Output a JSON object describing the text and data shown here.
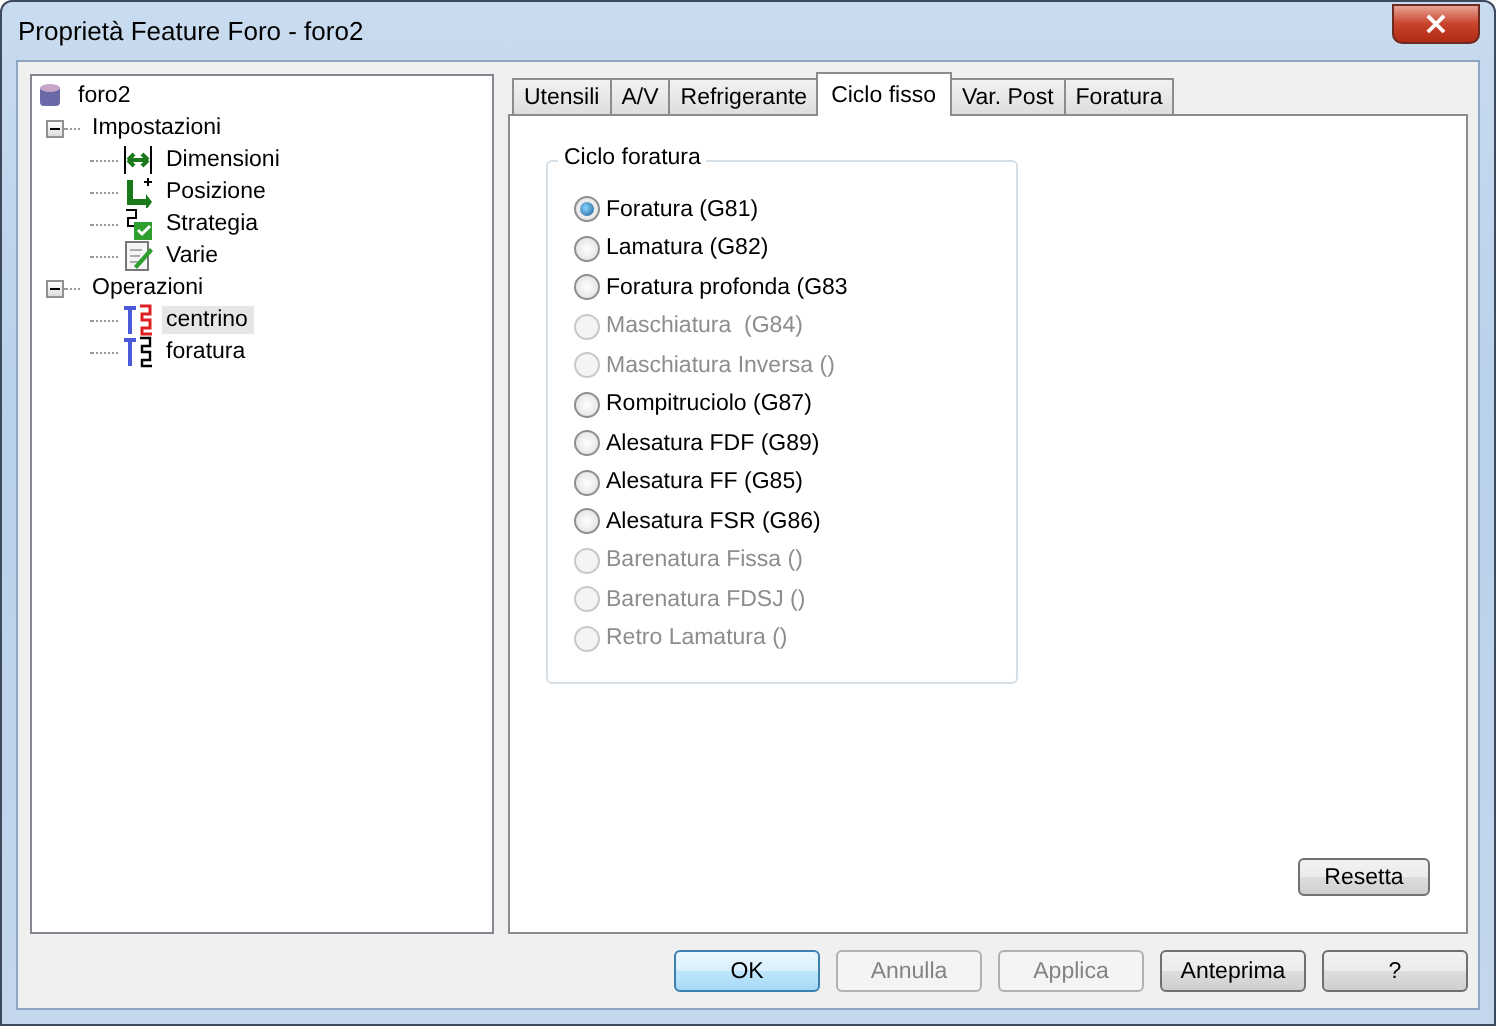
{
  "window": {
    "title": "Proprietà Feature Foro - foro2",
    "close": "×"
  },
  "tree": [
    {
      "label": "foro2",
      "kind": "database",
      "selected": false,
      "children": [
        {
          "label": "Impostazioni",
          "expanded": true,
          "selected": false,
          "children": [
            {
              "label": "Dimensioni",
              "kind": "dimension",
              "selected": false
            },
            {
              "label": "Posizione",
              "kind": "position",
              "selected": false
            },
            {
              "label": "Strategia",
              "kind": "strategy",
              "selected": false
            },
            {
              "label": "Varie",
              "kind": "notes",
              "selected": false
            }
          ]
        },
        {
          "label": "Operazioni",
          "expanded": true,
          "selected": false,
          "children": [
            {
              "label": "centrino",
              "kind": "tool-red",
              "selected": true
            },
            {
              "label": "foratura",
              "kind": "tool",
              "selected": false
            }
          ]
        }
      ]
    }
  ],
  "tabs": [
    {
      "label": "Utensili",
      "selected": false
    },
    {
      "label": "A/V",
      "selected": false
    },
    {
      "label": "Refrigerante",
      "selected": false
    },
    {
      "label": "Ciclo fisso",
      "selected": true
    },
    {
      "label": "Var. Post",
      "selected": false
    },
    {
      "label": "Foratura",
      "selected": false
    }
  ],
  "group": {
    "title": "Ciclo foratura",
    "options": [
      {
        "label": "Foratura (G81)",
        "selected": true,
        "disabled": false
      },
      {
        "label": "Lamatura (G82)",
        "selected": false,
        "disabled": false
      },
      {
        "label": "Foratura profonda (G83",
        "selected": false,
        "disabled": false
      },
      {
        "label": "Maschiatura  (G84)",
        "selected": false,
        "disabled": true
      },
      {
        "label": "Maschiatura Inversa ()",
        "selected": false,
        "disabled": true
      },
      {
        "label": "Rompitruciolo (G87)",
        "selected": false,
        "disabled": false
      },
      {
        "label": "Alesatura FDF (G89)",
        "selected": false,
        "disabled": false
      },
      {
        "label": "Alesatura FF (G85)",
        "selected": false,
        "disabled": false
      },
      {
        "label": "Alesatura FSR (G86)",
        "selected": false,
        "disabled": false
      },
      {
        "label": "Barenatura Fissa ()",
        "selected": false,
        "disabled": true
      },
      {
        "label": "Barenatura FDSJ ()",
        "selected": false,
        "disabled": true
      },
      {
        "label": "Retro Lamatura ()",
        "selected": false,
        "disabled": true
      }
    ]
  },
  "reset_button": "Resetta",
  "buttons": [
    {
      "label": "OK",
      "default": true,
      "disabled": false
    },
    {
      "label": "Annulla",
      "default": false,
      "disabled": true
    },
    {
      "label": "Applica",
      "default": false,
      "disabled": true
    },
    {
      "label": "Anteprima",
      "default": false,
      "disabled": false
    },
    {
      "label": "?",
      "default": false,
      "disabled": false
    }
  ]
}
